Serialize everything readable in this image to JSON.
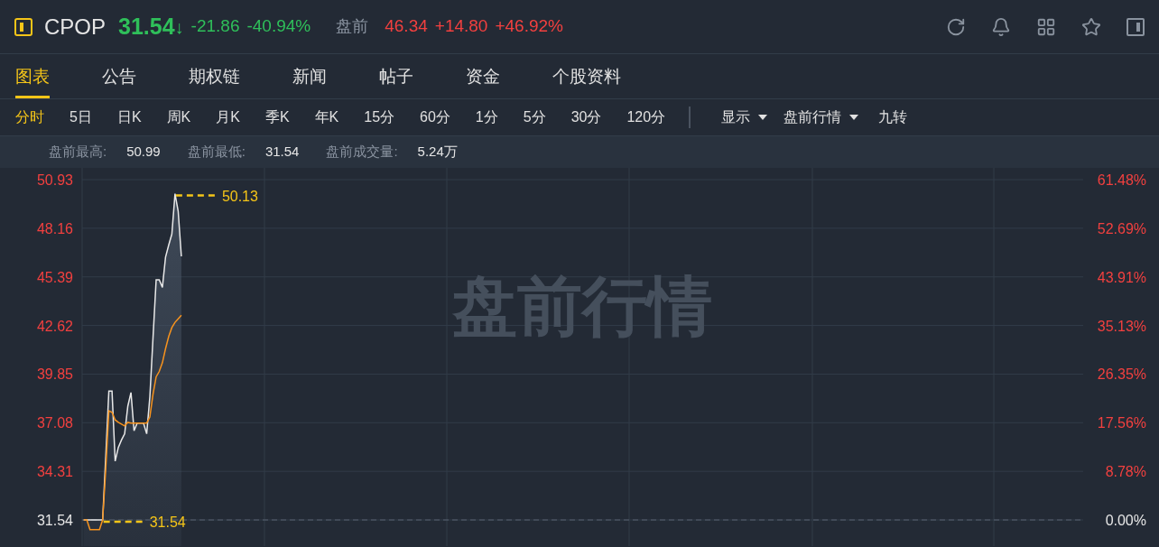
{
  "quote": {
    "symbol": "CPOP",
    "price": "31.54",
    "arrow": "↓",
    "change": "-21.86",
    "change_pct": "-40.94%",
    "session_label": "盘前",
    "session_price": "46.34",
    "session_change": "+14.80",
    "session_change_pct": "+46.92%"
  },
  "tabs": [
    {
      "label": "图表",
      "selected": true
    },
    {
      "label": "公告",
      "selected": false
    },
    {
      "label": "期权链",
      "selected": false
    },
    {
      "label": "新闻",
      "selected": false
    },
    {
      "label": "帖子",
      "selected": false
    },
    {
      "label": "资金",
      "selected": false
    },
    {
      "label": "个股资料",
      "selected": false
    }
  ],
  "periods": [
    {
      "label": "分时",
      "selected": true
    },
    {
      "label": "5日",
      "selected": false
    },
    {
      "label": "日K",
      "selected": false
    },
    {
      "label": "周K",
      "selected": false
    },
    {
      "label": "月K",
      "selected": false
    },
    {
      "label": "季K",
      "selected": false
    },
    {
      "label": "年K",
      "selected": false
    },
    {
      "label": "15分",
      "selected": false
    },
    {
      "label": "60分",
      "selected": false
    },
    {
      "label": "1分",
      "selected": false
    },
    {
      "label": "5分",
      "selected": false
    },
    {
      "label": "30分",
      "selected": false
    },
    {
      "label": "120分",
      "selected": false
    }
  ],
  "tools": [
    {
      "label": "显示",
      "kind": "dropdown"
    },
    {
      "label": "盘前行情",
      "kind": "dropdown"
    },
    {
      "label": "九转",
      "kind": "button"
    }
  ],
  "stats": [
    {
      "label": "盘前最高:",
      "value": "50.99"
    },
    {
      "label": "盘前最低:",
      "value": "31.54"
    },
    {
      "label": "盘前成交量:",
      "value": "5.24万"
    }
  ],
  "chart": {
    "watermark": "盘前行情",
    "percent_ticks": [
      "61.48%",
      "52.69%",
      "43.91%",
      "35.13%",
      "26.35%",
      "17.56%",
      "8.78%",
      "0.00%"
    ],
    "chart_data": {
      "type": "line",
      "grid": true,
      "categories": [
        null,
        null,
        null,
        null,
        null,
        null,
        null,
        null,
        null,
        null,
        null,
        null,
        null,
        null,
        null,
        null,
        null,
        null,
        null,
        null,
        null,
        null,
        null,
        null,
        null,
        null,
        null,
        null,
        null,
        null,
        null,
        null,
        null,
        null,
        null,
        null,
        null,
        null,
        null,
        null,
        null,
        null,
        null,
        null,
        null,
        null,
        null,
        null,
        null,
        null,
        null,
        null,
        null,
        null,
        null,
        null,
        null,
        null,
        null,
        null,
        null,
        null,
        null,
        null,
        null,
        null,
        null,
        null,
        null,
        null,
        null,
        null,
        null,
        null,
        null,
        null,
        null,
        null,
        null,
        null,
        null,
        null,
        null,
        null,
        null,
        null,
        null,
        null,
        null,
        null,
        null,
        null,
        null,
        null,
        null,
        null,
        null,
        null,
        null,
        null,
        null,
        null,
        null,
        null,
        null,
        null,
        null,
        null,
        null,
        null,
        null,
        null,
        null,
        null,
        null,
        null,
        null,
        null,
        null,
        null,
        null,
        null,
        null,
        null,
        null,
        null,
        null,
        null,
        null,
        null,
        null,
        null,
        null,
        null,
        null,
        null,
        null,
        null,
        null,
        null,
        null,
        null,
        null,
        null,
        null,
        null,
        null,
        null,
        null,
        null,
        null,
        null,
        null,
        null,
        null,
        null,
        null,
        null,
        null,
        null,
        null,
        null,
        null,
        null,
        null,
        null,
        null,
        null,
        null,
        null,
        null,
        null,
        null,
        null,
        null,
        null,
        null,
        null,
        null,
        null,
        null,
        null,
        null,
        null,
        null,
        null,
        null,
        null,
        null,
        null,
        null,
        null,
        null,
        null,
        null,
        null,
        null,
        null,
        null,
        null,
        null,
        null,
        null,
        null,
        null,
        null,
        null,
        null,
        null,
        null,
        null,
        null,
        null,
        null,
        null,
        null,
        null,
        null,
        null,
        null,
        null,
        null,
        null,
        null,
        null,
        null,
        null,
        null,
        null,
        null,
        null,
        null,
        null,
        null,
        null,
        null,
        null,
        null,
        null,
        null,
        null,
        null,
        null,
        null,
        null,
        null,
        null,
        null,
        null,
        null,
        null,
        null,
        null,
        null,
        null,
        null,
        null,
        null,
        null,
        null,
        null,
        null,
        null,
        null,
        null,
        null,
        null,
        null,
        null,
        null,
        null,
        null,
        null,
        null,
        null,
        null,
        null,
        null,
        null,
        null,
        null,
        null,
        null,
        null,
        null,
        null,
        null,
        null,
        null,
        null,
        null,
        null,
        null,
        null,
        null,
        null,
        null,
        null,
        null,
        null,
        null,
        null,
        null,
        null,
        null,
        null,
        null,
        null,
        null,
        null,
        null,
        null,
        null,
        null,
        null,
        null,
        null,
        null
      ],
      "ylim": [
        30.05,
        51.6
      ],
      "yticks": [
        {
          "value": 50.93,
          "label": "50.93"
        },
        {
          "value": 48.16,
          "label": "48.16"
        },
        {
          "value": 45.39,
          "label": "45.39"
        },
        {
          "value": 42.62,
          "label": "42.62"
        },
        {
          "value": 39.85,
          "label": "39.85"
        },
        {
          "value": 37.08,
          "label": "37.08"
        },
        {
          "value": 34.31,
          "label": "34.31"
        },
        {
          "value": 31.54,
          "label": "31.54"
        }
      ],
      "series": [
        {
          "color": "#e8e8e8",
          "values": [
            31.54,
            31.54,
            31.54,
            31.54,
            31.54,
            31.54,
            31.54,
            35.2,
            38.88,
            38.88,
            34.89,
            35.67,
            36.1,
            36.45,
            38.02,
            38.8,
            36.63,
            37.06,
            37.06,
            37.06,
            36.45,
            38.54,
            41.9,
            45.22,
            45.22,
            44.79,
            46.52,
            47.2,
            47.83,
            50.13,
            49.13,
            46.56,
            null,
            null,
            null,
            null,
            null,
            null,
            null,
            null,
            null,
            null,
            null,
            null,
            null,
            null,
            null,
            null,
            null,
            null,
            null,
            null,
            null,
            null,
            null,
            null,
            null,
            null,
            null,
            null,
            null,
            null,
            null,
            null,
            null,
            null,
            null,
            null,
            null,
            null,
            null,
            null,
            null,
            null,
            null,
            null,
            null,
            null,
            null,
            null,
            null,
            null,
            null,
            null,
            null,
            null,
            null,
            null,
            null,
            null,
            null,
            null,
            null,
            null,
            null,
            null,
            null,
            null,
            null,
            null,
            null,
            null,
            null,
            null,
            null,
            null,
            null,
            null,
            null,
            null,
            null,
            null,
            null,
            null,
            null,
            null,
            null,
            null,
            null,
            null,
            null,
            null,
            null,
            null,
            null,
            null,
            null,
            null,
            null,
            null,
            null,
            null,
            null,
            null,
            null,
            null,
            null,
            null,
            null,
            null,
            null,
            null,
            null,
            null,
            null,
            null,
            null,
            null,
            null,
            null,
            null,
            null,
            null,
            null,
            null,
            null,
            null,
            null,
            null,
            null,
            null,
            null,
            null,
            null,
            null,
            null,
            null,
            null,
            null,
            null,
            null,
            null,
            null,
            null,
            null,
            null,
            null,
            null,
            null,
            null,
            null,
            null,
            null,
            null,
            null,
            null,
            null,
            null,
            null,
            null,
            null,
            null,
            null,
            null,
            null,
            null,
            null,
            null,
            null,
            null,
            null,
            null,
            null,
            null,
            null,
            null,
            null,
            null,
            null,
            null,
            null,
            null,
            null,
            null,
            null,
            null,
            null,
            null,
            null,
            null,
            null,
            null,
            null,
            null,
            null,
            null,
            null,
            null,
            null,
            null,
            null,
            null,
            null,
            null,
            null,
            null,
            null,
            null,
            null,
            null,
            null,
            null,
            null,
            null,
            null,
            null,
            null,
            null,
            null,
            null,
            null,
            null,
            null,
            null,
            null,
            null,
            null,
            null,
            null,
            null,
            null,
            null,
            null,
            null,
            null,
            null,
            null,
            null,
            null,
            null,
            null,
            null,
            null,
            null,
            null,
            null,
            null,
            null,
            null,
            null,
            null,
            null,
            null,
            null,
            null,
            null,
            null,
            null,
            null,
            null,
            null,
            null,
            null,
            null,
            null,
            null,
            null,
            null,
            null,
            null,
            null,
            null,
            null,
            null,
            null,
            null,
            null,
            null,
            null,
            null,
            null,
            null,
            null,
            null,
            null,
            null,
            null,
            null
          ]
        },
        {
          "color": "#f7931e",
          "values": [
            31.54,
            31.54,
            30.99,
            30.99,
            30.99,
            30.99,
            31.54,
            34.5,
            37.76,
            37.67,
            37.24,
            37.1,
            37.0,
            36.9,
            37.1,
            37.06,
            37.06,
            37.06,
            37.06,
            37.06,
            37.06,
            37.4,
            38.7,
            39.7,
            40.0,
            40.5,
            41.3,
            42.0,
            42.5,
            42.8,
            43.0,
            43.2,
            null,
            null,
            null,
            null,
            null,
            null,
            null,
            null,
            null,
            null,
            null,
            null,
            null,
            null,
            null,
            null,
            null,
            null,
            null,
            null,
            null,
            null,
            null,
            null,
            null,
            null,
            null,
            null,
            null,
            null,
            null,
            null,
            null,
            null,
            null,
            null,
            null,
            null,
            null,
            null,
            null,
            null,
            null,
            null,
            null,
            null,
            null,
            null,
            null,
            null,
            null,
            null,
            null,
            null,
            null,
            null,
            null,
            null,
            null,
            null,
            null,
            null,
            null,
            null,
            null,
            null,
            null,
            null,
            null,
            null,
            null,
            null,
            null,
            null,
            null,
            null,
            null,
            null,
            null,
            null,
            null,
            null,
            null,
            null,
            null,
            null,
            null,
            null,
            null,
            null,
            null,
            null,
            null,
            null,
            null,
            null,
            null,
            null,
            null,
            null,
            null,
            null,
            null,
            null,
            null,
            null,
            null,
            null,
            null,
            null,
            null,
            null,
            null,
            null,
            null,
            null,
            null,
            null,
            null,
            null,
            null,
            null,
            null,
            null,
            null,
            null,
            null,
            null,
            null,
            null,
            null,
            null,
            null,
            null,
            null,
            null,
            null,
            null,
            null,
            null,
            null,
            null,
            null,
            null,
            null,
            null,
            null,
            null,
            null,
            null,
            null,
            null,
            null,
            null,
            null,
            null,
            null,
            null,
            null,
            null,
            null,
            null,
            null,
            null,
            null,
            null,
            null,
            null,
            null,
            null,
            null,
            null,
            null,
            null,
            null,
            null,
            null,
            null,
            null,
            null,
            null,
            null,
            null,
            null,
            null,
            null,
            null,
            null,
            null,
            null,
            null,
            null,
            null,
            null,
            null,
            null,
            null,
            null,
            null,
            null,
            null,
            null,
            null,
            null,
            null,
            null,
            null,
            null,
            null,
            null,
            null,
            null,
            null,
            null,
            null,
            null,
            null,
            null,
            null,
            null,
            null,
            null,
            null,
            null,
            null,
            null,
            null,
            null,
            null,
            null,
            null,
            null,
            null,
            null,
            null,
            null,
            null,
            null,
            null,
            null,
            null,
            null,
            null,
            null,
            null,
            null,
            null,
            null,
            null,
            null,
            null,
            null,
            null,
            null,
            null,
            null,
            null,
            null,
            null,
            null,
            null,
            null,
            null,
            null,
            null,
            null,
            null,
            null,
            null,
            null,
            null,
            null,
            null,
            null,
            null,
            null,
            null,
            null,
            null,
            null,
            null,
            null,
            null,
            null,
            null,
            null
          ]
        }
      ],
      "ref_lines": [
        {
          "axis": "y",
          "value": 31.54
        }
      ],
      "annotations": [
        "50.13",
        "31.54"
      ]
    }
  }
}
